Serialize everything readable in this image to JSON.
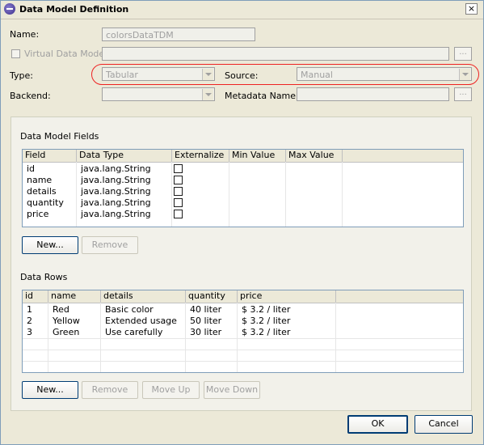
{
  "window": {
    "title": "Data Model Definition",
    "close_symbol": "×"
  },
  "form": {
    "name_label": "Name:",
    "name_value": "colorsDataTDM",
    "virtual_label": "Virtual Data Model",
    "virtual_value": "",
    "dots": "...",
    "type_label": "Type:",
    "type_value": "Tabular",
    "source_label": "Source:",
    "source_value": "Manual",
    "backend_label": "Backend:",
    "backend_value": "",
    "metadata_label": "Metadata Name:",
    "metadata_value": ""
  },
  "fields_section": {
    "title": "Data Model Fields",
    "columns": [
      "Field",
      "Data Type",
      "Externalize",
      "Min Value",
      "Max Value"
    ],
    "rows": [
      {
        "field": "id",
        "type": "java.lang.String",
        "externalize": false
      },
      {
        "field": "name",
        "type": "java.lang.String",
        "externalize": false
      },
      {
        "field": "details",
        "type": "java.lang.String",
        "externalize": false
      },
      {
        "field": "quantity",
        "type": "java.lang.String",
        "externalize": false
      },
      {
        "field": "price",
        "type": "java.lang.String",
        "externalize": false
      }
    ],
    "new_button": "New...",
    "remove_button": "Remove"
  },
  "rows_section": {
    "title": "Data Rows",
    "columns": [
      "id",
      "name",
      "details",
      "quantity",
      "price"
    ],
    "rows": [
      {
        "id": "1",
        "name": "Red",
        "details": "Basic color",
        "quantity": "40 liter",
        "price": "$ 3.2 / liter"
      },
      {
        "id": "2",
        "name": "Yellow",
        "details": "Extended usage",
        "quantity": "50 liter",
        "price": "$ 3.2 / liter"
      },
      {
        "id": "3",
        "name": "Green",
        "details": "Use carefully",
        "quantity": "30 liter",
        "price": "$ 3.2 / liter"
      }
    ],
    "new_button": "New...",
    "remove_button": "Remove",
    "move_up_button": "Move Up",
    "move_down_button": "Move Down"
  },
  "footer": {
    "ok_button": "OK",
    "cancel_button": "Cancel"
  },
  "colors": {
    "highlight": "#e22222",
    "accent": "#003c74"
  }
}
